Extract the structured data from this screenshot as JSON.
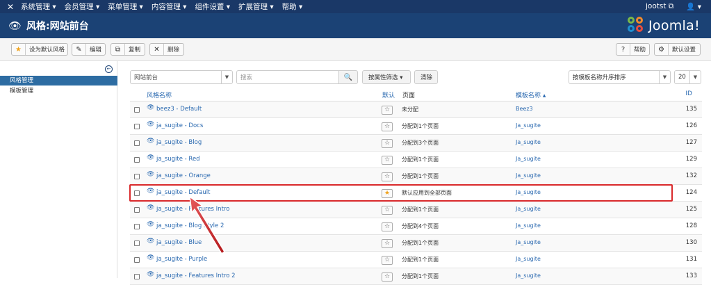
{
  "topnav": {
    "logo": "✕",
    "menu": [
      "系统管理 ▾",
      "会员管理 ▾",
      "菜单管理 ▾",
      "内容管理 ▾",
      "组件设置 ▾",
      "扩展管理 ▾",
      "帮助 ▾"
    ],
    "user": "jootst ⧉",
    "account": "👤 ▾"
  },
  "header": {
    "title": "风格:网站前台",
    "brand": "Joomla!"
  },
  "toolbar": {
    "set_default": "设为默认风格",
    "edit": "编辑",
    "copy": "复制",
    "delete": "删除",
    "help": "帮助",
    "options": "默认设置"
  },
  "sidebar": {
    "items": [
      "风格管理",
      "模板管理"
    ]
  },
  "filters": {
    "location": "网站前台",
    "search_placeholder": "搜索",
    "filter_btn": "按属性筛选 ▾",
    "clear_btn": "清除",
    "sort": "按模板名称升序排序",
    "limit": "20"
  },
  "table": {
    "headers": {
      "name": "风格名称",
      "default": "默认",
      "pages": "页面",
      "template": "模板名称 ▴",
      "id": "ID"
    },
    "rows": [
      {
        "name": "beez3 - Default",
        "pages": "未分配",
        "template": "Beez3",
        "id": "135",
        "default": false
      },
      {
        "name": "ja_sugite - Docs",
        "pages": "分配到1个页面",
        "template": "Ja_sugite",
        "id": "126",
        "default": false
      },
      {
        "name": "ja_sugite - Blog",
        "pages": "分配到3个页面",
        "template": "Ja_sugite",
        "id": "127",
        "default": false
      },
      {
        "name": "ja_sugite - Red",
        "pages": "分配到1个页面",
        "template": "Ja_sugite",
        "id": "129",
        "default": false
      },
      {
        "name": "ja_sugite - Orange",
        "pages": "分配到1个页面",
        "template": "Ja_sugite",
        "id": "132",
        "default": false
      },
      {
        "name": "ja_sugite - Default",
        "pages": "默认应用到全部页面",
        "template": "Ja_sugite",
        "id": "124",
        "default": true
      },
      {
        "name": "ja_sugite - Features Intro",
        "pages": "分配到1个页面",
        "template": "Ja_sugite",
        "id": "125",
        "default": false
      },
      {
        "name": "ja_sugite - Blog Style 2",
        "pages": "分配到4个页面",
        "template": "Ja_sugite",
        "id": "128",
        "default": false
      },
      {
        "name": "ja_sugite - Blue",
        "pages": "分配到1个页面",
        "template": "Ja_sugite",
        "id": "130",
        "default": false
      },
      {
        "name": "ja_sugite - Purple",
        "pages": "分配到1个页面",
        "template": "Ja_sugite",
        "id": "131",
        "default": false
      },
      {
        "name": "ja_sugite - Features Intro 2",
        "pages": "分配到1个页面",
        "template": "Ja_sugite",
        "id": "133",
        "default": false
      }
    ]
  },
  "colors": {
    "nav": "#1a3867",
    "header": "#1b4275",
    "active": "#2d6ca2",
    "link": "#2a69b0",
    "annotation": "#d9292b",
    "star_on": "#f0a21b"
  }
}
